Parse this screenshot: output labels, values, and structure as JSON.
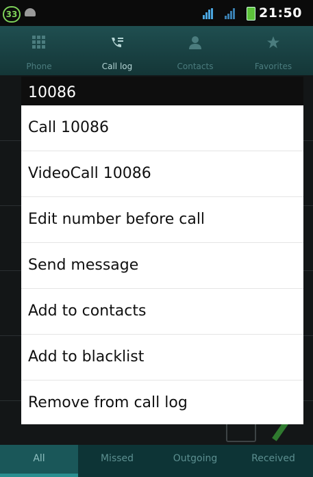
{
  "status_bar": {
    "badge_count": "33",
    "time": "21:50"
  },
  "tabs": [
    {
      "label": "Phone",
      "icon": "keypad-icon"
    },
    {
      "label": "Call log",
      "icon": "call-log-icon",
      "active": true
    },
    {
      "label": "Contacts",
      "icon": "person-icon"
    },
    {
      "label": "Favorites",
      "icon": "star-icon"
    }
  ],
  "dialog": {
    "title": "10086",
    "items": [
      "Call 10086",
      "VideoCall 10086",
      "Edit number before call",
      "Send message",
      "Add to contacts",
      "Add to blacklist",
      "Remove from call log"
    ]
  },
  "filters": [
    {
      "label": "All",
      "active": true
    },
    {
      "label": "Missed"
    },
    {
      "label": "Outgoing"
    },
    {
      "label": "Received"
    }
  ],
  "colors": {
    "accent": "#2a8e90",
    "tab_bar": "#1f4e50",
    "dialog_title_bg": "#0e0e0e"
  }
}
